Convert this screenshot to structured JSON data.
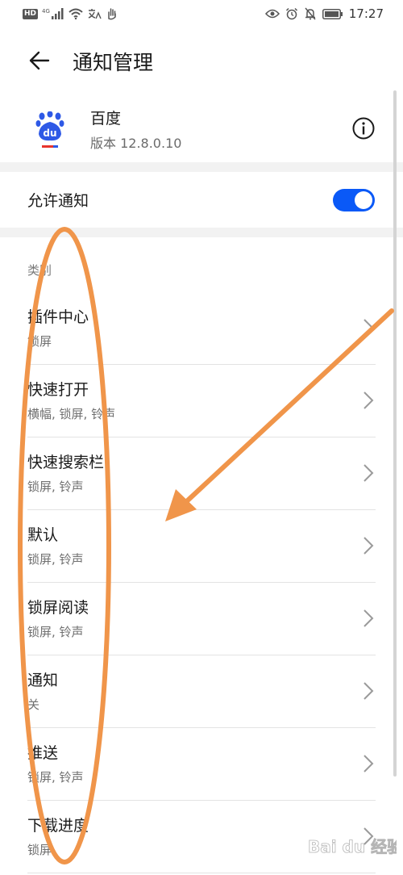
{
  "status_bar": {
    "hd": "HD",
    "network": "4G",
    "time": "17:27"
  },
  "header": {
    "title": "通知管理"
  },
  "app": {
    "name": "百度",
    "version": "版本 12.8.0.10",
    "icon_text": "du"
  },
  "allow": {
    "label": "允许通知",
    "enabled": true
  },
  "category_label": "类别",
  "items": [
    {
      "title": "插件中心",
      "sub": "锁屏"
    },
    {
      "title": "快速打开",
      "sub": "横幅, 锁屏, 铃声"
    },
    {
      "title": "快速搜索栏",
      "sub": "锁屏, 铃声"
    },
    {
      "title": "默认",
      "sub": "锁屏, 铃声"
    },
    {
      "title": "锁屏阅读",
      "sub": "锁屏, 铃声"
    },
    {
      "title": "通知",
      "sub": "关"
    },
    {
      "title": "推送",
      "sub": "锁屏, 铃声"
    },
    {
      "title": "下载进度",
      "sub": "锁屏"
    }
  ],
  "watermark": {
    "text": "Bai du 经验"
  },
  "colors": {
    "accent": "#0a59f7",
    "annotation": "#f0954a",
    "baidu_blue": "#2e59e6",
    "baidu_red": "#e8342d"
  }
}
